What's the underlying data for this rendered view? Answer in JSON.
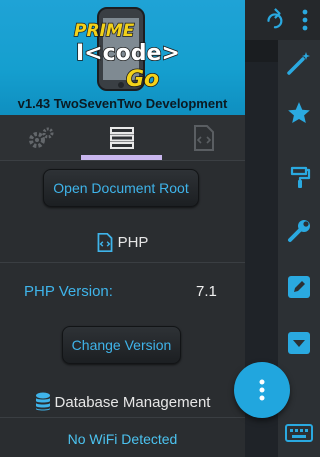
{
  "header": {
    "logo_word_top": "PRIME",
    "logo_word_middle": "I<code>",
    "logo_word_bottom": "Go",
    "version": "v1.43 TwoSevenTwo Development"
  },
  "tabs": [
    {
      "icon": "gears-icon",
      "selected": false
    },
    {
      "icon": "server-icon",
      "selected": true
    },
    {
      "icon": "code-file-icon",
      "selected": false
    }
  ],
  "buttons": {
    "open_document_root": "Open Document Root",
    "change_version": "Change Version"
  },
  "php": {
    "title": "PHP",
    "version_label": "PHP Version:",
    "version_value": "7.1"
  },
  "database": {
    "title": "Database Management"
  },
  "status": {
    "wifi": "No WiFi Detected"
  },
  "toolbar": {
    "icons": [
      "redo-icon",
      "more-vert-icon",
      "magic-wand-icon",
      "star-icon",
      "paint-roller-icon",
      "wrench-icon",
      "edit-icon",
      "collapse-icon",
      "keyboard-icon"
    ]
  },
  "colors": {
    "accent": "#21a6de",
    "link_blue": "#3fb4ea",
    "tab_indicator": "#c9b6ee",
    "header_blue": "#159fcf"
  }
}
